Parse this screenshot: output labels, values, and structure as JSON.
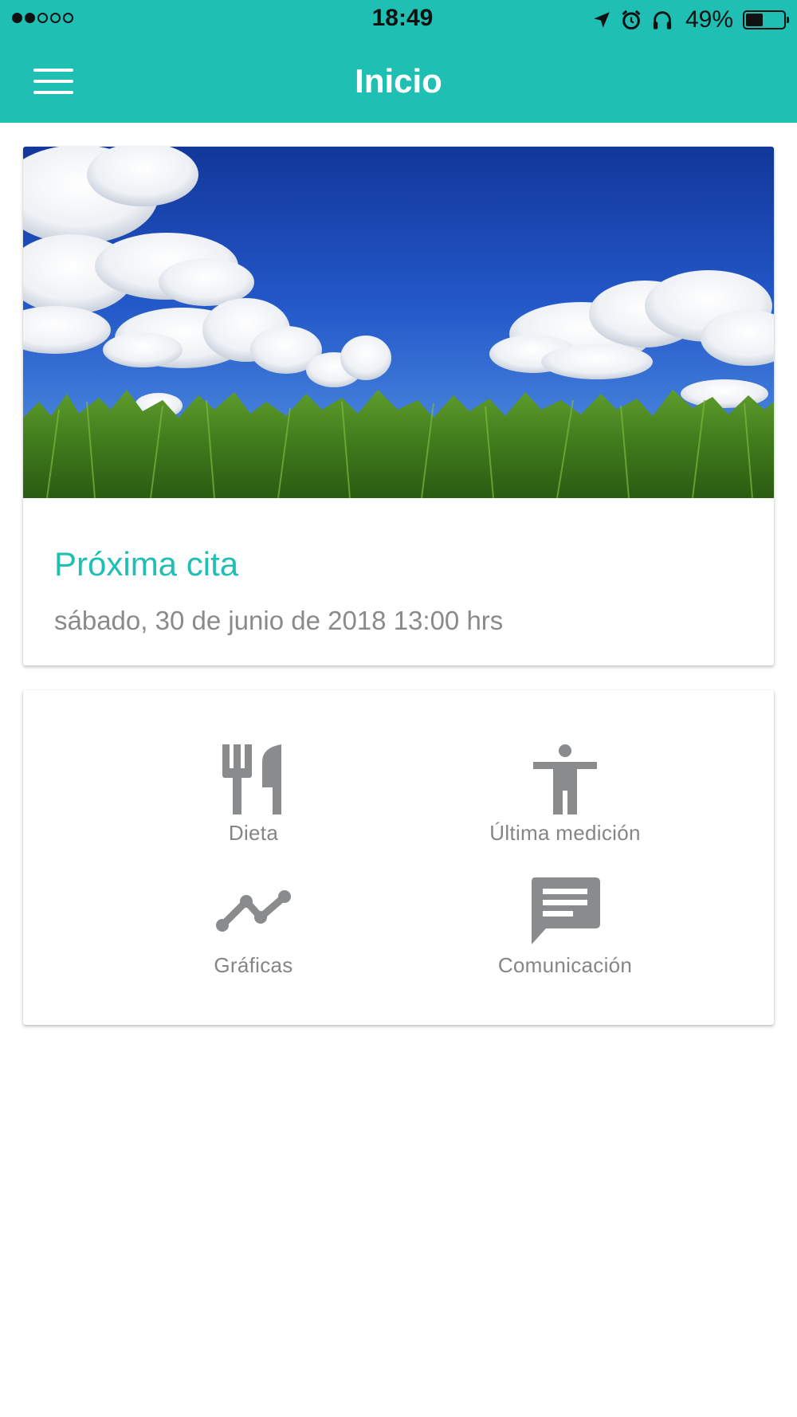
{
  "status_bar": {
    "time": "18:49",
    "battery": "49%",
    "battery_level": 0.49,
    "signal_bars_filled": 2,
    "signal_bars_total": 5,
    "icons": [
      "location-arrow-icon",
      "alarm-icon",
      "headphones-icon",
      "battery-icon"
    ]
  },
  "app_bar": {
    "title": "Inicio",
    "menu_icon": "hamburger-menu-icon",
    "color": "#1fbfb4"
  },
  "appointment_card": {
    "image": "sky-and-grass-photo",
    "title": "Próxima cita",
    "date": "sábado, 30 de junio de 2018 13:00 hrs"
  },
  "shortcuts": [
    {
      "label": "Dieta",
      "icon": "fork-knife-icon"
    },
    {
      "label": "Última medición",
      "icon": "person-standing-icon"
    },
    {
      "label": "Gráficas",
      "icon": "line-chart-icon"
    },
    {
      "label": "Comunicación",
      "icon": "chat-message-icon"
    }
  ],
  "colors": {
    "accent": "#1fbfb4",
    "icon_gray": "#8a8b8d",
    "text_gray": "#858585"
  }
}
